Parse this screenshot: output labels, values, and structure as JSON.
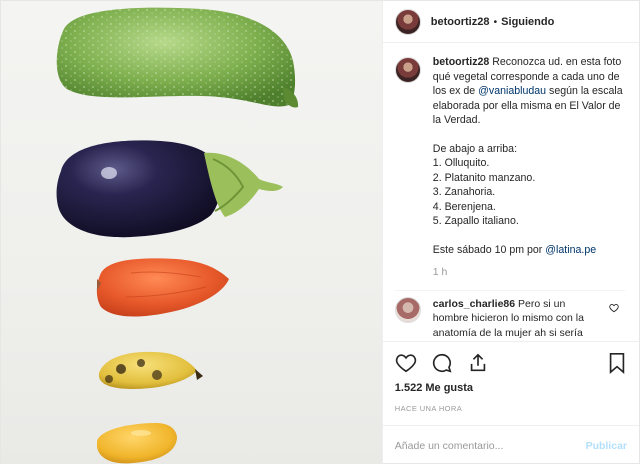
{
  "header": {
    "username": "betoortiz28",
    "separator": "•",
    "follow_status": "Siguiendo"
  },
  "caption": {
    "username": "betoortiz28",
    "intro": "Reconozca ud. en esta foto qué vegetal corresponde a cada uno de los ex de",
    "mention1": "@vaniabludau",
    "intro2": "según la escala elaborada por ella misma en El Valor de la Verdad.",
    "list_title": "De abajo a arriba:",
    "list": [
      "1. Olluquito.",
      "2. Platanito manzano.",
      "3. Zanahoria.",
      "4. Berenjena.",
      "5. Zapallo italiano."
    ],
    "footer_text": "Este sábado 10 pm por",
    "mention2": "@latina.pe",
    "age": "1 h"
  },
  "comment": {
    "username": "carlos_charlie86",
    "text": "Pero si un hombre hicieron lo mismo con la anatomía de la mujer ah si sería"
  },
  "actions": {
    "icons": [
      "heart-icon",
      "comment-icon",
      "share-icon",
      "bookmark-icon"
    ],
    "likes": "1.522 Me gusta",
    "posted": "HACE UNA HORA"
  },
  "add_comment": {
    "placeholder": "Añade un comentario...",
    "publish": "Publicar"
  },
  "colors": {
    "link": "#003569",
    "muted": "#999999",
    "publish_disabled": "#b2dffc",
    "zucchini": "#7fb04f",
    "eggplant": "#1f1a3a",
    "carrot": "#e85a2b",
    "banana": "#e7c640",
    "olluco": "#f0b52b"
  }
}
